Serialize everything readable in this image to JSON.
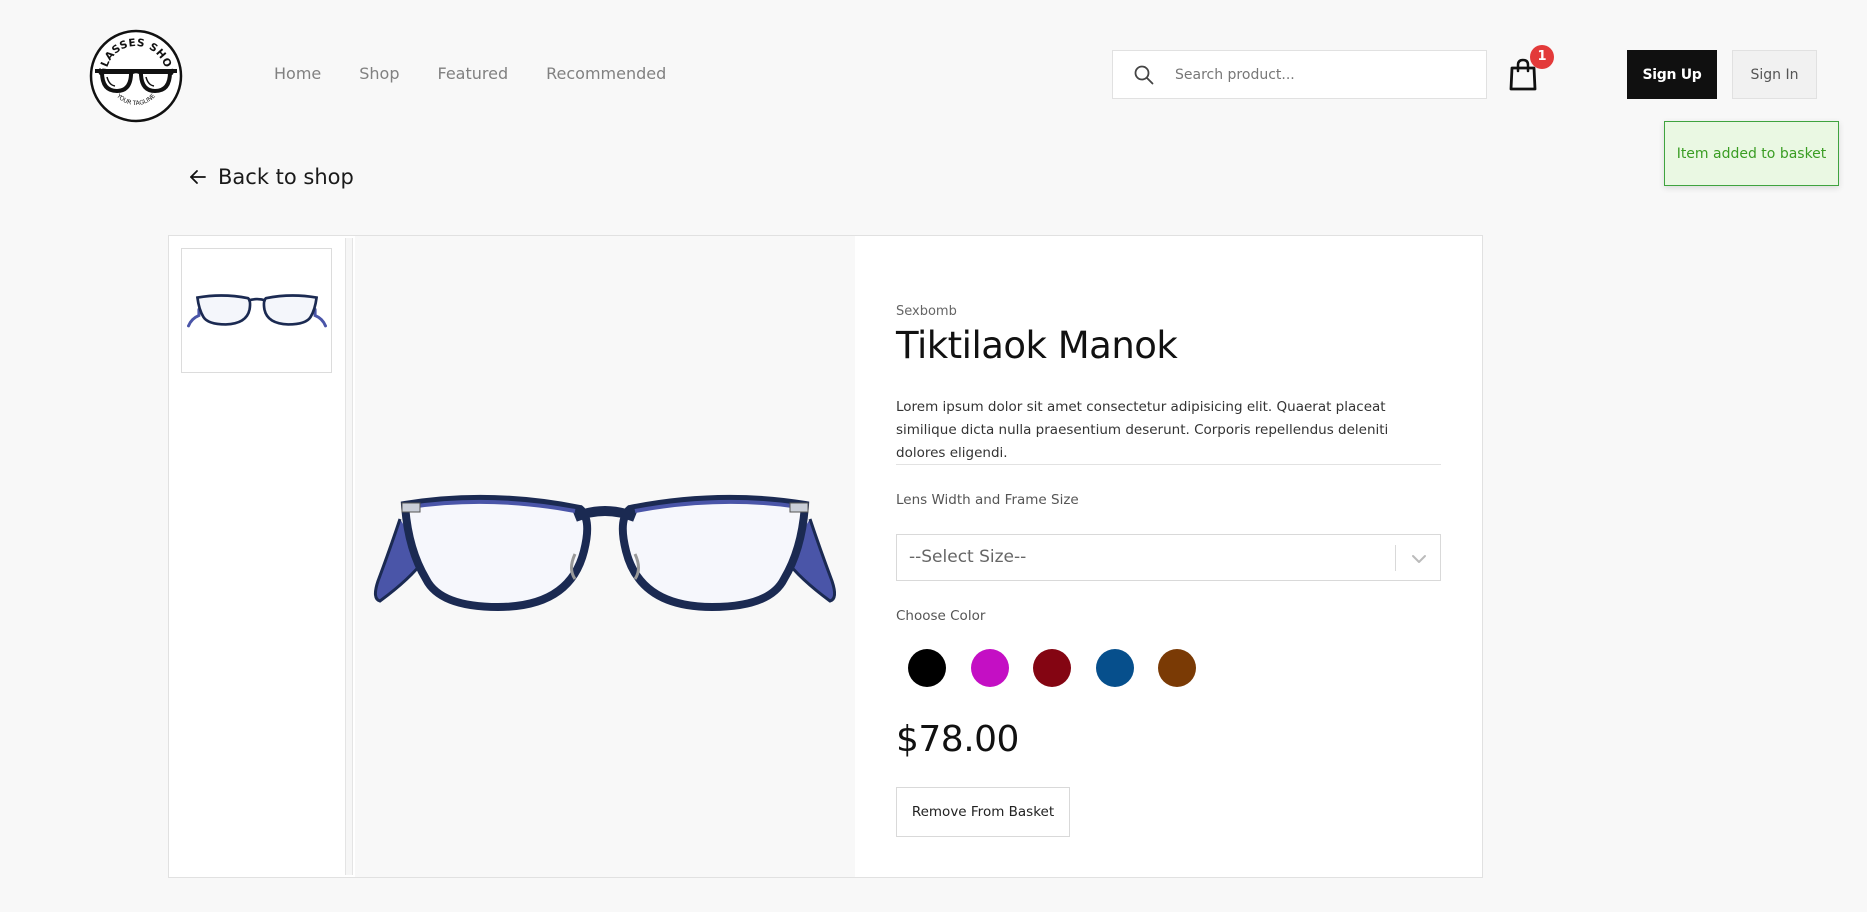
{
  "logo": {
    "top_text": "GLASSES SHOP",
    "bottom_text": "YOUR TAGLINE"
  },
  "nav": {
    "items": [
      {
        "label": "Home"
      },
      {
        "label": "Shop"
      },
      {
        "label": "Featured"
      },
      {
        "label": "Recommended"
      }
    ]
  },
  "search": {
    "placeholder": "Search product...",
    "icon": "search-icon"
  },
  "basket": {
    "icon": "shopping-bag-icon",
    "count": "1",
    "badge_color": "#e33a3a"
  },
  "auth": {
    "signup_label": "Sign Up",
    "signin_label": "Sign In"
  },
  "toast": {
    "message": "Item added to basket"
  },
  "back": {
    "label": "Back to shop",
    "icon": "arrow-left-icon"
  },
  "product": {
    "brand": "Sexbomb",
    "name": "Tiktilaok Manok",
    "description": "Lorem ipsum dolor sit amet consectetur adipisicing elit. Quaerat placeat similique dicta nulla praesentium deserunt. Corporis repellendus deleniti dolores eligendi.",
    "size_label": "Lens Width and Frame Size",
    "size_value": "--Select Size--",
    "color_label": "Choose Color",
    "colors": [
      "#000000",
      "#c40fc4",
      "#840512",
      "#064f8c",
      "#7a3a05"
    ],
    "price": "$78.00",
    "remove_label": "Remove From Basket",
    "frame_color": "#1b2a52",
    "temple_color": "#4a55a8"
  }
}
